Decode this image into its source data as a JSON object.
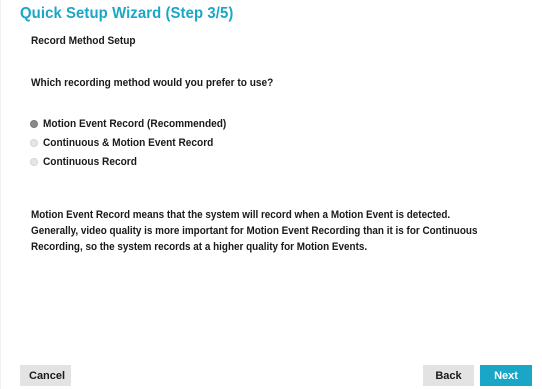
{
  "wizard": {
    "title": "Quick Setup Wizard (Step 3/5)",
    "section_title": "Record Method Setup",
    "question": "Which recording method would you prefer to use?",
    "options": [
      {
        "label": "Motion Event Record (Recommended)",
        "selected": true
      },
      {
        "label": "Continuous & Motion Event Record",
        "selected": false
      },
      {
        "label": "Continuous Record",
        "selected": false
      }
    ],
    "description": "Motion Event Record means that the system will record when a Motion Event is detected. Generally, video quality is more important for Motion Event Recording than it is for Continuous Recording, so the system records at a higher quality for Motion Events.",
    "buttons": {
      "cancel": "Cancel",
      "back": "Back",
      "next": "Next"
    }
  },
  "colors": {
    "accent": "#1aa7c7",
    "button_gray": "#e3e3e3",
    "radio_selected": "#8a8a8a",
    "radio_unselected": "#e6e6e6"
  }
}
